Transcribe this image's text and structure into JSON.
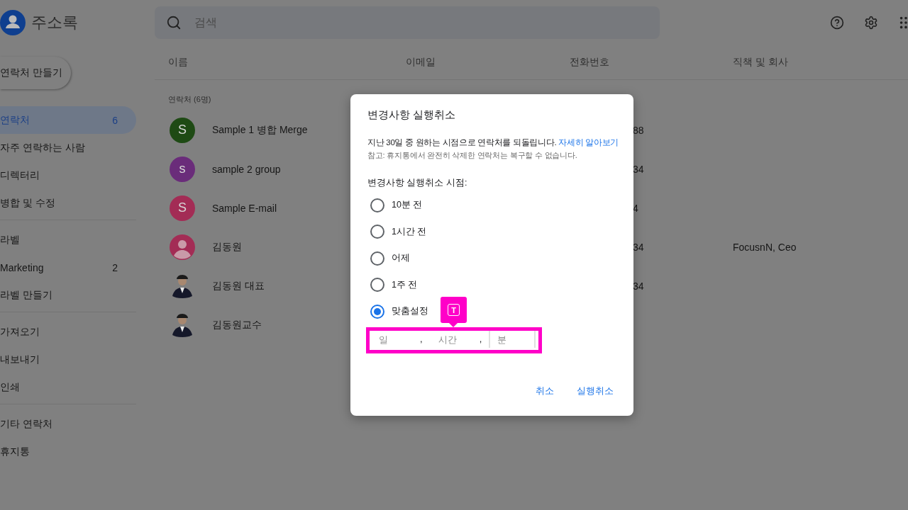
{
  "app": {
    "title": "주소록"
  },
  "search": {
    "placeholder": "검색"
  },
  "sidebar": {
    "create_button": "연락처 만들기",
    "groups": [
      [
        {
          "label": "연락처",
          "count": "6",
          "selected": true
        },
        {
          "label": "자주 연락하는 사람",
          "selected": false
        },
        {
          "label": "디렉터리",
          "selected": false
        },
        {
          "label": "병합 및 수정",
          "selected": false
        }
      ],
      [
        {
          "label": "라벨",
          "selected": false
        },
        {
          "label": "Marketing",
          "count": "2",
          "selected": false
        },
        {
          "label": "라벨 만들기",
          "selected": false
        }
      ],
      [
        {
          "label": "가져오기",
          "selected": false
        },
        {
          "label": "내보내기",
          "selected": false
        },
        {
          "label": "인쇄",
          "selected": false
        }
      ],
      [
        {
          "label": "기타 연락처",
          "selected": false
        },
        {
          "label": "휴지통",
          "selected": false
        }
      ]
    ]
  },
  "table": {
    "columns": [
      "이름",
      "이메일",
      "전화번호",
      "직책 및 회사"
    ],
    "section_label": "연락처 (6명)",
    "rows": [
      {
        "name": "Sample 1 병합 Merge",
        "avatar": {
          "kind": "letter",
          "letter": "S",
          "color": "#1e4a14"
        },
        "phone": "88"
      },
      {
        "name": "sample 2 group",
        "avatar": {
          "kind": "letter",
          "letter": "s",
          "color": "#6a2c7a"
        },
        "phone": "34"
      },
      {
        "name": "Sample E-mail",
        "avatar": {
          "kind": "letter",
          "letter": "S",
          "color": "#a32c55"
        },
        "phone": "4"
      },
      {
        "name": "김동원",
        "avatar": {
          "kind": "person",
          "color": "#a32c55"
        },
        "phone": "34",
        "company": "FocusnN, Ceo"
      },
      {
        "name": "김동원 대표",
        "phone": "34"
      },
      {
        "name": "김동원교수"
      }
    ]
  },
  "dialog": {
    "title": "변경사항 실행취소",
    "description": "지난 30일 중 원하는 시점으로 연락처를 되돌립니다.",
    "link": "자세히 알아보기",
    "note": "참고: 휴지통에서 완전히 삭제한 연락처는 복구할 수 없습니다.",
    "prompt": "변경사항 실행취소 시점:",
    "options": [
      {
        "label": "10분 전",
        "selected": false
      },
      {
        "label": "1시간 전",
        "selected": false
      },
      {
        "label": "어제",
        "selected": false
      },
      {
        "label": "1주 전",
        "selected": false
      },
      {
        "label": "맞춤설정",
        "selected": true
      }
    ],
    "fields": [
      {
        "placeholder": "일",
        "focused": false,
        "separator": ","
      },
      {
        "placeholder": "시간",
        "focused": false,
        "separator": ","
      },
      {
        "placeholder": "분",
        "focused": true
      }
    ],
    "buttons": [
      "취소",
      "실행취소"
    ]
  },
  "annotation": {
    "icon_text": "T"
  }
}
